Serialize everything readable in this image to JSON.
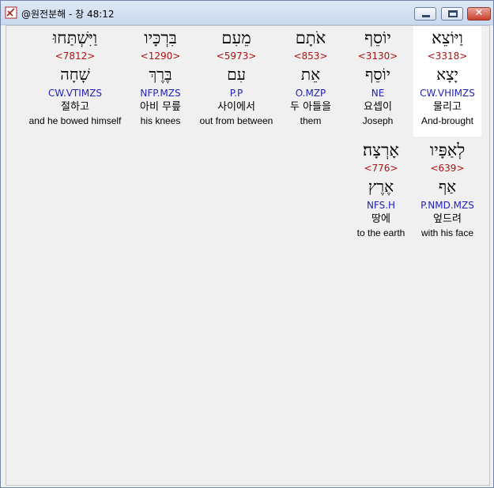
{
  "window": {
    "title": "@원전분해 - 창 48:12",
    "icons": {
      "app": "app-icon",
      "minimize": "minimize-icon",
      "maximize": "maximize-icon",
      "close": "close-icon"
    },
    "close_glyph": "✕"
  },
  "words": [
    {
      "hebrew": "וַיּוֹצֵא",
      "strong": "<3318>",
      "lemma": "יָצָא",
      "parse": "CW.VHIMZS",
      "korean": "물리고",
      "english": "And-brought"
    },
    {
      "hebrew": "יוֹסֵף",
      "strong": "<3130>",
      "lemma": "יוֹסֵף",
      "parse": "NE",
      "korean": "요셉이",
      "english": "Joseph"
    },
    {
      "hebrew": "אֹתָם",
      "strong": "<853>",
      "lemma": "אֵת",
      "parse": "O.MZP",
      "korean": "두 아들을",
      "english": "them"
    },
    {
      "hebrew": "מֵעִם",
      "strong": "<5973>",
      "lemma": "עִם",
      "parse": "P.P",
      "korean": "사이에서",
      "english": "out from between"
    },
    {
      "hebrew": "בִּרְכָּיו",
      "strong": "<1290>",
      "lemma": "בֶּרֶךְ",
      "parse": "NFP.MZS",
      "korean": "아비 무릎",
      "english": "his knees"
    },
    {
      "hebrew": "וַיִּשְׁתַּחוּ",
      "strong": "<7812>",
      "lemma": "שָׁחָה",
      "parse": "CW.VTIMZS",
      "korean": "절하고",
      "english": "and he bowed himself"
    },
    {
      "hebrew": "לְאַפָּיו",
      "strong": "<639>",
      "lemma": "אַף",
      "parse": "P.NMD.MZS",
      "korean": "엎드려",
      "english": "with his face"
    },
    {
      "hebrew": "אָרְצָה׃",
      "strong": "<776>",
      "lemma": "אֶרֶץ",
      "parse": "NFS.H",
      "korean": "땅에",
      "english": "to the earth"
    }
  ]
}
